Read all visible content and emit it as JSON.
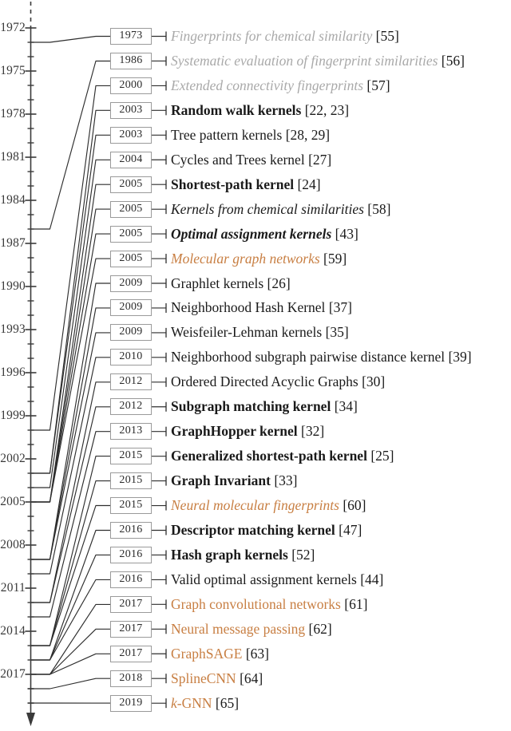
{
  "figure": {
    "kind": "timeline",
    "axis": {
      "label_years": [
        "1972",
        "1975",
        "1978",
        "1981",
        "1984",
        "1987",
        "1990",
        "1993",
        "1996",
        "1999",
        "2002",
        "2005",
        "2008",
        "2011",
        "2014",
        "2017"
      ],
      "tick_step_years": 3,
      "minor_ticks_per_major": 3,
      "top_dashed": true,
      "bottom_arrow": true,
      "axis_color": "#3a3a3a"
    },
    "colors": {
      "text_default": "#1a1a1a",
      "text_muted": "#a9a9a9",
      "accent_orange": "#c87f43",
      "box_border": "#9a9a9a",
      "line": "#2e2e2e"
    },
    "entries": [
      {
        "year": "1973",
        "title": "Fingerprints for chemical similarity",
        "ref": "[55]",
        "style": "s-gray"
      },
      {
        "year": "1986",
        "title": "Systematic evaluation of fingerprint similarities",
        "ref": "[56]",
        "style": "s-gray"
      },
      {
        "year": "2000",
        "title": "Extended connectivity fingerprints",
        "ref": "[57]",
        "style": "s-gray"
      },
      {
        "year": "2003",
        "title": "Random walk kernels",
        "ref": "[22, 23]",
        "style": "s-bold"
      },
      {
        "year": "2003",
        "title": "Tree pattern kernels",
        "ref": "[28, 29]",
        "style": "s-plain"
      },
      {
        "year": "2004",
        "title": "Cycles and Trees kernel",
        "ref": "[27]",
        "style": "s-plain"
      },
      {
        "year": "2005",
        "title": "Shortest-path kernel",
        "ref": "[24]",
        "style": "s-bold"
      },
      {
        "year": "2005",
        "title": "Kernels from chemical similarities",
        "ref": "[58]",
        "style": "s-italic"
      },
      {
        "year": "2005",
        "title": "Optimal assignment kernels",
        "ref": "[43]",
        "style": "s-bolditalic"
      },
      {
        "year": "2005",
        "title": "Molecular graph networks",
        "ref": "[59]",
        "style": "s-orange-italic"
      },
      {
        "year": "2009",
        "title": "Graphlet kernels",
        "ref": "[26]",
        "style": "s-plain"
      },
      {
        "year": "2009",
        "title": "Neighborhood Hash Kernel",
        "ref": "[37]",
        "style": "s-plain"
      },
      {
        "year": "2009",
        "title": "Weisfeiler-Lehman kernels",
        "ref": "[35]",
        "style": "s-plain"
      },
      {
        "year": "2010",
        "title": "Neighborhood subgraph pairwise distance kernel",
        "ref": "[39]",
        "style": "s-plain"
      },
      {
        "year": "2012",
        "title": "Ordered Directed Acyclic Graphs",
        "ref": "[30]",
        "style": "s-plain"
      },
      {
        "year": "2012",
        "title": "Subgraph matching kernel",
        "ref": "[34]",
        "style": "s-bold"
      },
      {
        "year": "2013",
        "title": "GraphHopper kernel",
        "ref": "[32]",
        "style": "s-bold"
      },
      {
        "year": "2015",
        "title": "Generalized shortest-path kernel",
        "ref": "[25]",
        "style": "s-bold"
      },
      {
        "year": "2015",
        "title": "Graph Invariant",
        "ref": "[33]",
        "style": "s-bold"
      },
      {
        "year": "2015",
        "title": "Neural molecular fingerprints",
        "ref": "[60]",
        "style": "s-orange-italic"
      },
      {
        "year": "2016",
        "title": "Descriptor matching kernel",
        "ref": "[47]",
        "style": "s-bold"
      },
      {
        "year": "2016",
        "title": "Hash graph kernels",
        "ref": "[52]",
        "style": "s-bold"
      },
      {
        "year": "2016",
        "title": "Valid optimal assignment kernels",
        "ref": "[44]",
        "style": "s-plain"
      },
      {
        "year": "2017",
        "title": "Graph convolutional networks",
        "ref": "[61]",
        "style": "s-orange"
      },
      {
        "year": "2017",
        "title": "Neural message passing",
        "ref": "[62]",
        "style": "s-orange"
      },
      {
        "year": "2017",
        "title": "GraphSAGE",
        "ref": "[63]",
        "style": "s-orange"
      },
      {
        "year": "2018",
        "title": "SplineCNN",
        "ref": "[64]",
        "style": "s-orange"
      },
      {
        "year": "2019",
        "title": "k-GNN",
        "ref": "[65]",
        "style": "s-orange",
        "italic_prefix": "k"
      }
    ]
  }
}
